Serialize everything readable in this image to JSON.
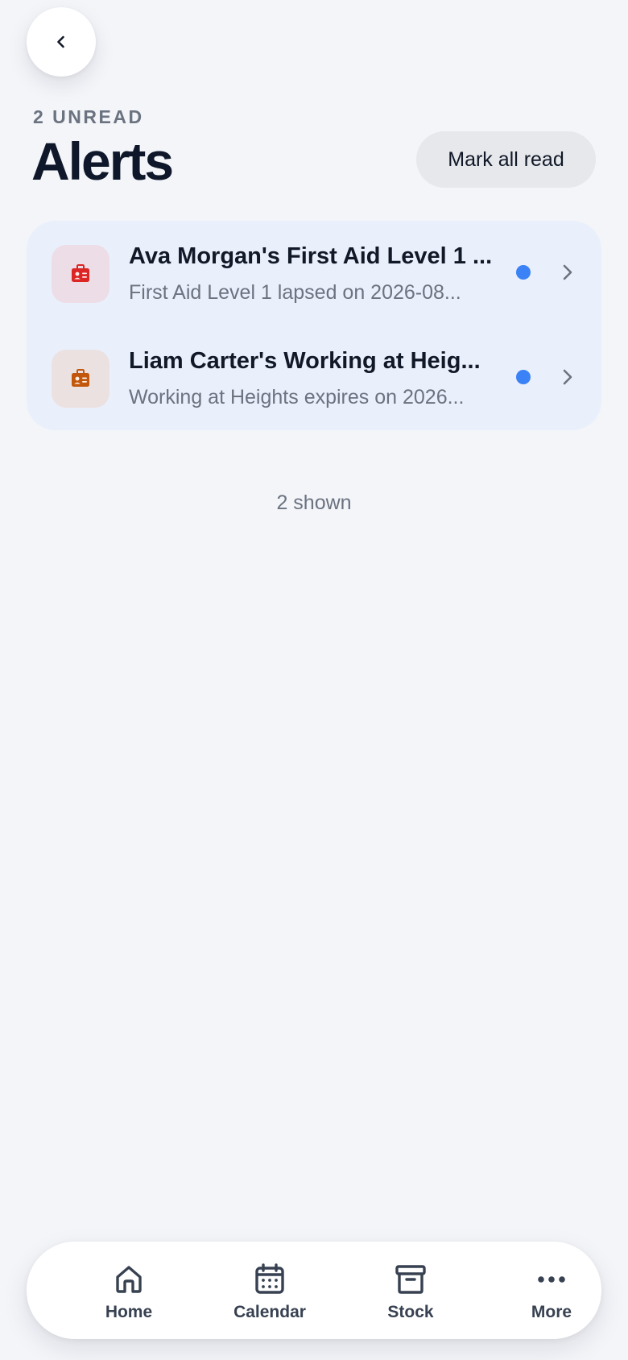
{
  "header": {
    "unread_label": "2 UNREAD",
    "title": "Alerts",
    "mark_all_label": "Mark all read"
  },
  "alerts": [
    {
      "title": "Ava Morgan's First Aid Level 1 ...",
      "subtitle": "First Aid Level 1 lapsed on 2026-08...",
      "icon": "id-badge-icon",
      "icon_color": "#dc2626",
      "icon_bg": "#ecdde6",
      "unread": true
    },
    {
      "title": "Liam Carter's Working at Heig...",
      "subtitle": "Working at Heights expires on 2026...",
      "icon": "id-badge-icon",
      "icon_color": "#c2570c",
      "icon_bg": "#ebe1e1",
      "unread": true
    }
  ],
  "footer": {
    "shown_label": "2 shown"
  },
  "nav": {
    "items": [
      {
        "label": "Home",
        "icon": "home-icon"
      },
      {
        "label": "Calendar",
        "icon": "calendar-icon"
      },
      {
        "label": "Stock",
        "icon": "archive-box-icon"
      },
      {
        "label": "More",
        "icon": "more-dots-icon"
      }
    ]
  },
  "colors": {
    "background": "#f3f5f9",
    "unread_dot": "#3b82f6",
    "list_bg": "#eaf0fb"
  }
}
